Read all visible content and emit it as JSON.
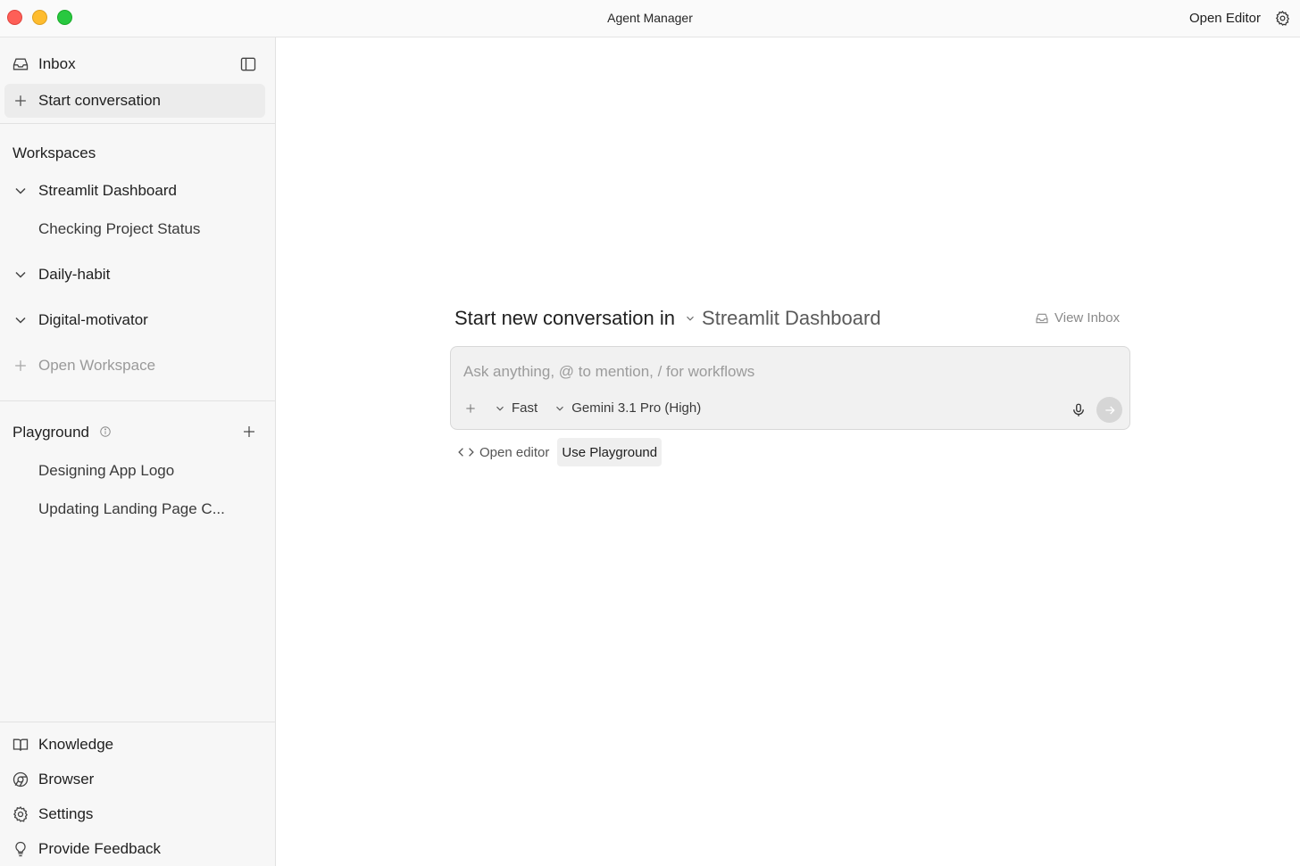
{
  "window": {
    "title": "Agent Manager",
    "open_editor_label": "Open Editor"
  },
  "sidebar": {
    "inbox_label": "Inbox",
    "start_conversation_label": "Start conversation",
    "workspaces_title": "Workspaces",
    "workspaces": [
      {
        "label": "Streamlit Dashboard",
        "children": [
          "Checking Project Status"
        ]
      },
      {
        "label": "Daily-habit"
      },
      {
        "label": "Digital-motivator"
      }
    ],
    "open_workspace_label": "Open Workspace",
    "playground_title": "Playground",
    "playground_items": [
      "Designing App Logo",
      "Updating Landing Page C..."
    ],
    "bottom_items": [
      {
        "label": "Knowledge",
        "icon": "book-icon"
      },
      {
        "label": "Browser",
        "icon": "chrome-icon"
      },
      {
        "label": "Settings",
        "icon": "gear-icon"
      },
      {
        "label": "Provide Feedback",
        "icon": "lightbulb-icon"
      }
    ]
  },
  "main": {
    "heading_prefix": "Start new conversation in",
    "heading_workspace": "Streamlit Dashboard",
    "view_inbox_label": "View Inbox",
    "composer": {
      "placeholder": "Ask anything, @ to mention, / for workflows",
      "mode_label": "Fast",
      "model_label": "Gemini 3.1 Pro (High)"
    },
    "open_editor_label": "Open editor",
    "use_playground_label": "Use Playground"
  }
}
